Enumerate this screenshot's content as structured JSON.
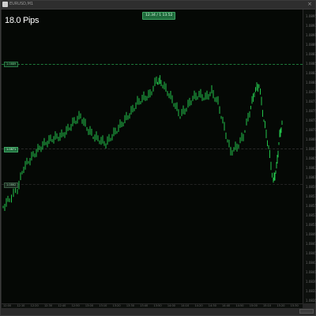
{
  "window": {
    "tab_label": "EURUSD,M1",
    "close_glyph": "×"
  },
  "chart": {
    "pips_label": "18.0 Pips",
    "top_badge": "12.34  /  1  13.52",
    "markers": {
      "top": "1.0889",
      "mid": "1.0871",
      "low": "1.0862"
    },
    "colors": {
      "background": "#050805",
      "bar": "#22c24a",
      "accent": "#1f6b3c"
    },
    "price_ticks": [
      "1.0895",
      "1.0893",
      "1.0891",
      "1.0889",
      "1.0887",
      "1.0885",
      "1.0883",
      "1.0881",
      "1.0879",
      "1.0877",
      "1.0875",
      "1.0873",
      "1.0871",
      "1.0869",
      "1.0867",
      "1.0865",
      "1.0863",
      "1.0861",
      "1.0859",
      "1.0857",
      "1.0855",
      "1.0853",
      "1.0851",
      "1.0849",
      "1.0847",
      "1.0845",
      "1.0843",
      "1.0841",
      "1.0839",
      "1.0837",
      "1.0835"
    ],
    "time_ticks": [
      "12:00",
      "12:10",
      "12:20",
      "12:30",
      "12:40",
      "12:50",
      "13:00",
      "13:10",
      "13:20",
      "13:30",
      "13:40",
      "13:50",
      "14:00",
      "14:10",
      "14:20",
      "14:30",
      "14:40",
      "14:50",
      "15:00",
      "15:10",
      "15:20",
      "15:30"
    ]
  }
}
